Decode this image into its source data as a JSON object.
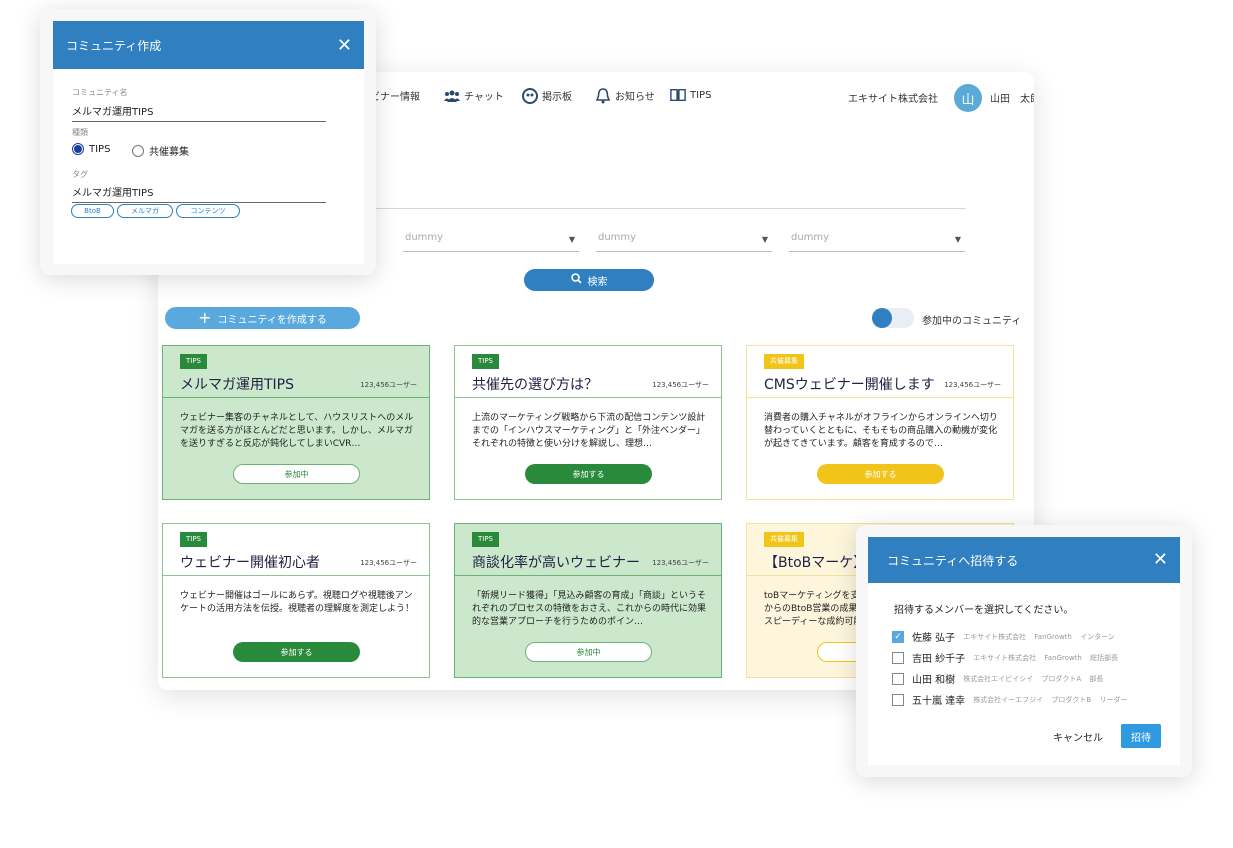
{
  "nav": {
    "items": [
      {
        "label": "ウェビナー情報",
        "icon": "webinar-icon"
      },
      {
        "label": "チャット",
        "icon": "people-icon"
      },
      {
        "label": "掲示板",
        "icon": "board-icon"
      },
      {
        "label": "お知らせ",
        "icon": "bell-icon"
      },
      {
        "label": "TIPS",
        "icon": "book-icon"
      }
    ],
    "company": "エキサイト株式会社",
    "avatar_initial": "山",
    "username": "山田　太郎"
  },
  "filters": {
    "placeholders": [
      "dummy",
      "dummy",
      "dummy"
    ]
  },
  "search_label": "検索",
  "create_label": "コミュニティを作成する",
  "toggle_label": "参加中のコミュニティ",
  "cards": [
    {
      "tag": "TIPS",
      "title": "メルマガ運用TIPS",
      "count": "123,456ユーザー",
      "desc": "ウェビナー集客のチャネルとして、ハウスリストへのメルマガを送る方がほとんどだと思います。しかし、メルマガを送りすぎると反応が鈍化してしまいCVR…",
      "button": "参加中"
    },
    {
      "tag": "TIPS",
      "title": "共催先の選び方は？",
      "count": "123,456ユーザー",
      "desc": "上流のマーケティング戦略から下流の配信コンテンツ設計までの「インハウスマーケティング」と「外注ベンダー」それぞれの特徴と使い分けを解説し、理想…",
      "button": "参加する"
    },
    {
      "tag": "共催募集",
      "title": "CMSウェビナー開催します",
      "count": "123,456ユーザー",
      "desc": "消費者の購入チャネルがオフラインからオンラインへ切り替わっていくとともに、そもそもの商品購入の動機が変化が起きてきています。顧客を育成するので…",
      "button": "参加する"
    },
    {
      "tag": "TIPS",
      "title": "ウェビナー開催初心者",
      "count": "123,456ユーザー",
      "desc": "ウェビナー開催はゴールにあらず。視聴ログや視聴後アンケートの活用方法を伝授。視聴者の理解度を測定しよう！",
      "button": "参加する"
    },
    {
      "tag": "TIPS",
      "title": "商談化率が高いウェビナー",
      "count": "123,456ユーザー",
      "desc": "「新規リード獲得」「見込み顧客の育成」「商談」というそれぞれのプロセスの特徴をおさえ、これからの時代に効果的な営業アプローチを行うためのポイン…",
      "button": "参加中"
    },
    {
      "tag": "共催募集",
      "title": "【BtoBマーケ】",
      "count": "",
      "desc": "toBマーケティングを支\nからのBtoB営業の成果の\nスピーディーな成約可能",
      "button": ""
    }
  ],
  "create_modal": {
    "title": "コミュニティ作成",
    "name_label": "コミュニティ名",
    "name_value": "メルマガ運用TIPS",
    "type_label": "種類",
    "type_options": [
      "TIPS",
      "共催募集"
    ],
    "tag_label": "タグ",
    "tag_value": "メルマガ運用TIPS",
    "chips": [
      "BtoB",
      "メルマガ",
      "コンテンツ"
    ]
  },
  "invite_modal": {
    "title": "コミュニティへ招待する",
    "prompt": "招待するメンバーを選択してください。",
    "members": [
      {
        "name": "佐藤 弘子",
        "meta": "エキサイト株式会社 FanGrowth インターン",
        "checked": true
      },
      {
        "name": "吉田 紗千子",
        "meta": "エキサイト株式会社 FanGrowth 総括部長",
        "checked": false
      },
      {
        "name": "山田 和樹",
        "meta": "株式会社エイビイシイ プロダクトA 部長",
        "checked": false
      },
      {
        "name": "五十嵐 達幸",
        "meta": "株式会社イーエフジイ プロダクトB リーダー",
        "checked": false
      }
    ],
    "cancel": "キャンセル",
    "invite": "招待"
  }
}
